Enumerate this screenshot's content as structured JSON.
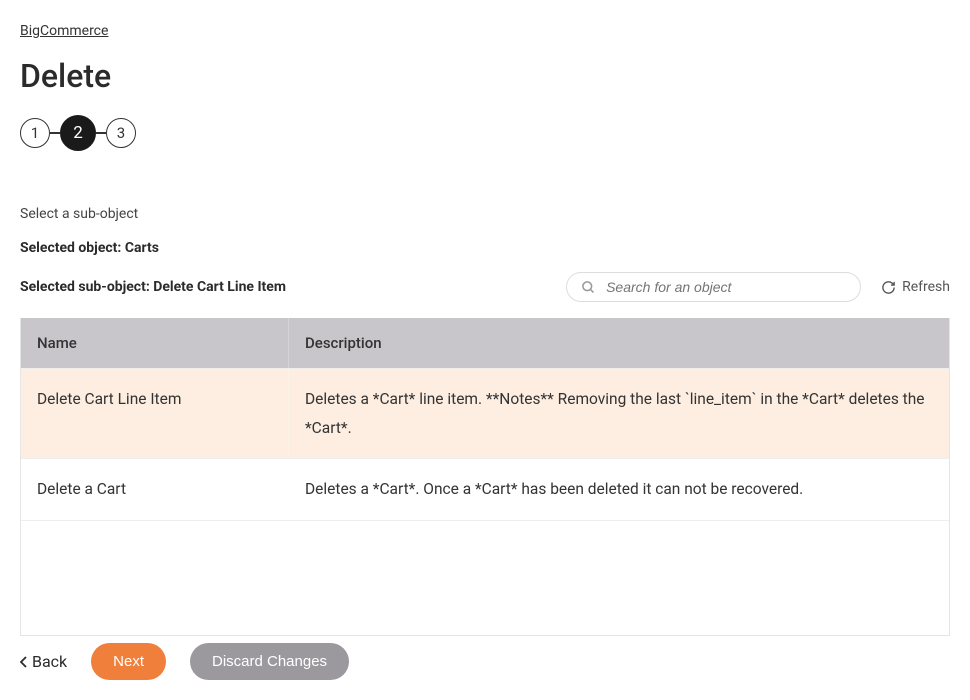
{
  "breadcrumb": {
    "label": "BigCommerce"
  },
  "page": {
    "title": "Delete"
  },
  "stepper": {
    "steps": [
      "1",
      "2",
      "3"
    ],
    "active_index": 1
  },
  "section": {
    "select_label": "Select a sub-object",
    "selected_object_label": "Selected object: Carts",
    "selected_sub_object_label": "Selected sub-object: Delete Cart Line Item"
  },
  "search": {
    "placeholder": "Search for an object"
  },
  "refresh": {
    "label": "Refresh"
  },
  "table": {
    "headers": {
      "name": "Name",
      "description": "Description"
    },
    "rows": [
      {
        "name": "Delete Cart Line Item",
        "description": "Deletes a *Cart* line item. **Notes** Removing the last `line_item` in the *Cart* deletes the *Cart*.",
        "selected": true
      },
      {
        "name": "Delete a Cart",
        "description": "Deletes a *Cart*. Once a *Cart* has been deleted it can not be recovered.",
        "selected": false
      }
    ]
  },
  "footer": {
    "back": "Back",
    "next": "Next",
    "discard": "Discard Changes"
  },
  "colors": {
    "accent": "#f07f3c",
    "row_selected": "#fdeee1",
    "header_bg": "#c8c6cb"
  }
}
